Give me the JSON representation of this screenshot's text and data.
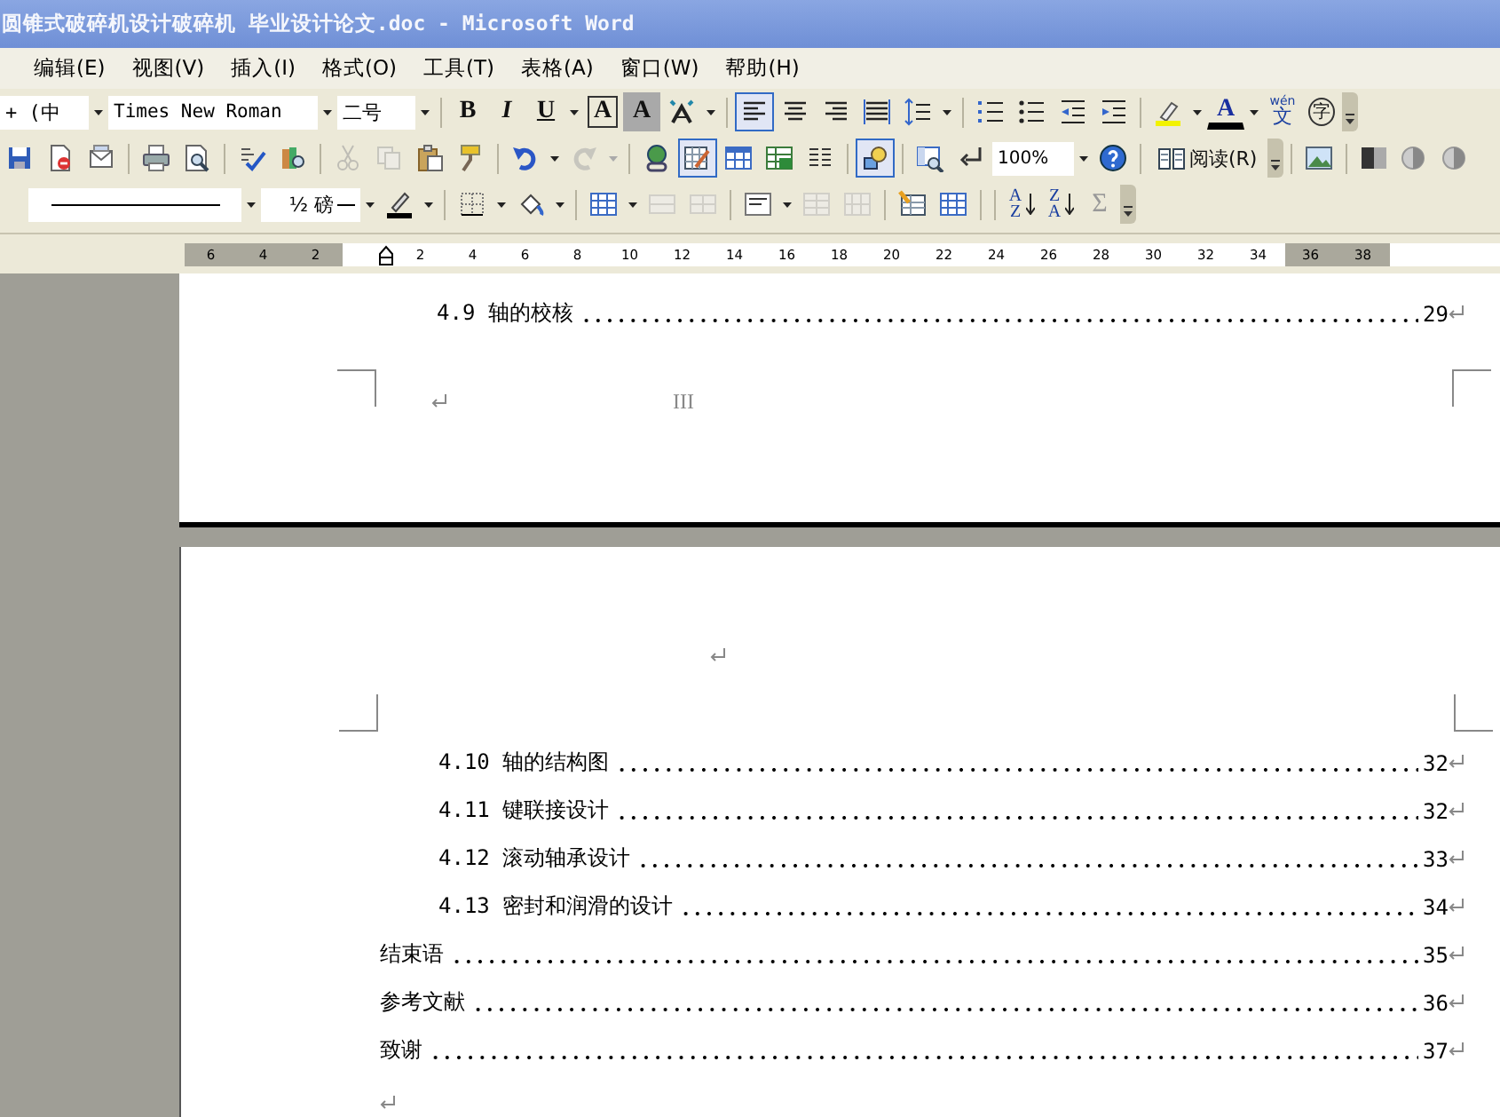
{
  "window": {
    "title": "圆锥式破碎机设计破碎机 毕业设计论文.doc - Microsoft Word"
  },
  "menu": [
    {
      "label": "编辑(E)"
    },
    {
      "label": "视图(V)"
    },
    {
      "label": "插入(I)"
    },
    {
      "label": "格式(O)"
    },
    {
      "label": "工具(T)"
    },
    {
      "label": "表格(A)"
    },
    {
      "label": "窗口(W)"
    },
    {
      "label": "帮助(H)"
    }
  ],
  "formatting_toolbar": {
    "style_box": "+ (中",
    "font_box": "Times New Roman",
    "size_box": "二号",
    "letter_buttons": [
      {
        "label": "B"
      },
      {
        "label": "I"
      },
      {
        "label": "U"
      },
      {
        "label": "A"
      },
      {
        "label": "A"
      }
    ],
    "alignment": [
      {
        "selected": true
      },
      {
        "selected": false
      },
      {
        "selected": false
      },
      {
        "selected": false
      }
    ],
    "font_color_label": "A",
    "phonetic_label": "wén",
    "phonetic_char": "文",
    "enclose_char": "字"
  },
  "standard_toolbar": {
    "buttons": [
      {
        "pressed": false,
        "disabled": false
      },
      {
        "pressed": false,
        "disabled": false
      },
      {
        "pressed": false,
        "disabled": false
      },
      {
        "pressed": false,
        "disabled": false
      },
      {
        "pressed": false,
        "disabled": false
      },
      {
        "pressed": false,
        "disabled": false
      },
      {
        "pressed": false,
        "disabled": false
      },
      {
        "pressed": false,
        "disabled": true
      },
      {
        "pressed": false,
        "disabled": true
      },
      {
        "pressed": false,
        "disabled": false
      },
      {
        "pressed": false,
        "disabled": false
      },
      {
        "pressed": false,
        "disabled": false
      },
      {
        "pressed": false,
        "disabled": true
      },
      {
        "pressed": false,
        "disabled": false
      },
      {
        "pressed": true,
        "disabled": false
      },
      {
        "pressed": false,
        "disabled": false
      },
      {
        "pressed": false,
        "disabled": false
      },
      {
        "pressed": false,
        "disabled": false
      },
      {
        "pressed": true,
        "disabled": false
      },
      {
        "pressed": false,
        "disabled": false
      },
      {
        "pressed": false,
        "disabled": false
      }
    ],
    "zoom_box": "100%",
    "read_button": "阅读(R)"
  },
  "tables_toolbar": {
    "line_weight": "½ 磅",
    "buttons": [
      {
        "disabled": false
      },
      {
        "disabled": false
      },
      {
        "disabled": false
      },
      {
        "disabled": true
      },
      {
        "disabled": true
      },
      {
        "disabled": false
      },
      {
        "disabled": true
      },
      {
        "disabled": true
      },
      {
        "disabled": false
      },
      {
        "disabled": false
      },
      {
        "disabled": true
      }
    ],
    "sort_ascending": {
      "top": "A",
      "bottom": "Z"
    },
    "sort_descending": {
      "top": "Z",
      "bottom": "A"
    },
    "sum_label": "Σ"
  },
  "ruler": {
    "left_labels": [
      "6",
      "4",
      "2"
    ],
    "labels": [
      "2",
      "4",
      "6",
      "8",
      "10",
      "12",
      "14",
      "16",
      "18",
      "20",
      "22",
      "24",
      "26",
      "28",
      "30",
      "32",
      "34"
    ],
    "right_labels": [
      "36",
      "38"
    ]
  },
  "page_1": {
    "entries": [
      {
        "kind": "section",
        "title": "4.9 轴的校核",
        "page": "29"
      }
    ],
    "page_number": "III"
  },
  "page_2": {
    "entries": [
      {
        "kind": "section",
        "title": "4.10 轴的结构图",
        "page": "32"
      },
      {
        "kind": "section",
        "title": "4.11  键联接设计",
        "page": "32"
      },
      {
        "kind": "section",
        "title": "4.12  滚动轴承设计",
        "page": "33"
      },
      {
        "kind": "section",
        "title": "4.13  密封和润滑的设计",
        "page": "34"
      },
      {
        "kind": "chapter",
        "title": "结束语",
        "page": "35"
      },
      {
        "kind": "chapter",
        "title": "参考文献",
        "page": "36"
      },
      {
        "kind": "chapter",
        "title": "致谢",
        "page": "37"
      }
    ]
  }
}
